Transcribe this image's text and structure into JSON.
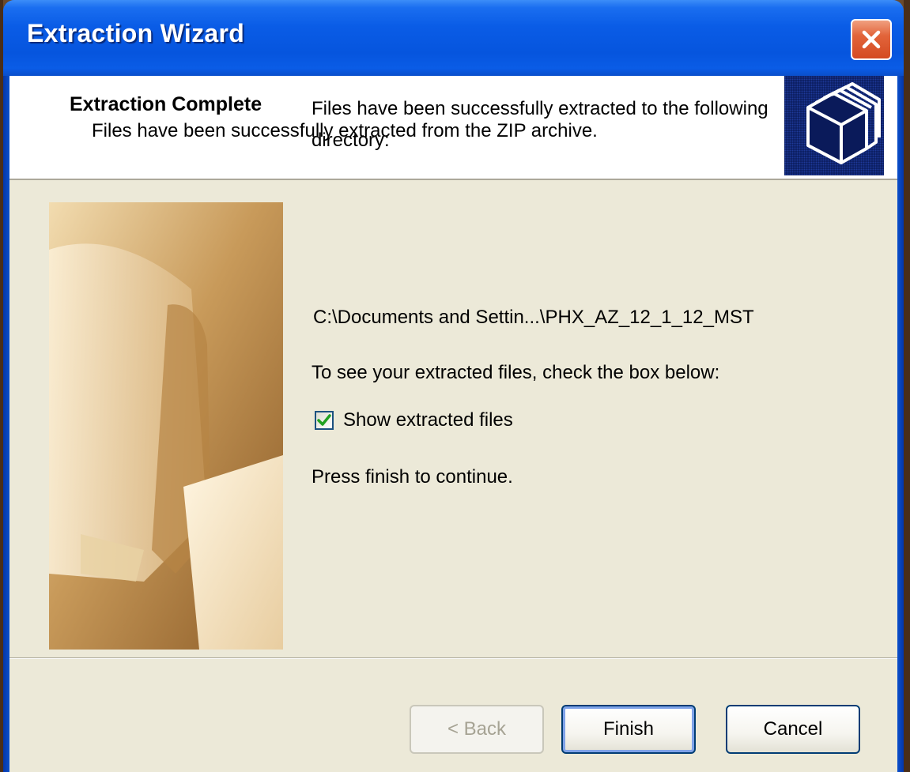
{
  "window": {
    "title": "Extraction Wizard"
  },
  "header": {
    "title": "Extraction Complete",
    "subtitle": "Files have been successfully extracted from the ZIP archive.",
    "icon": "folders-icon"
  },
  "body": {
    "message_line1": "Files have been successfully extracted to the following",
    "message_line2": "directory:",
    "path": "C:\\Documents and Settin...\\PHX_AZ_12_1_12_MST",
    "instruction": "To see your extracted files, check the box below:",
    "checkbox_label": "Show extracted files",
    "checkbox_checked": true,
    "continue_text": "Press finish to continue."
  },
  "buttons": {
    "back": "< Back",
    "finish": "Finish",
    "cancel": "Cancel"
  },
  "colors": {
    "titlebar": "#0a5ce6",
    "client_bg": "#ece9d8",
    "close_button": "#d44a22",
    "checkmark": "#21a121"
  }
}
